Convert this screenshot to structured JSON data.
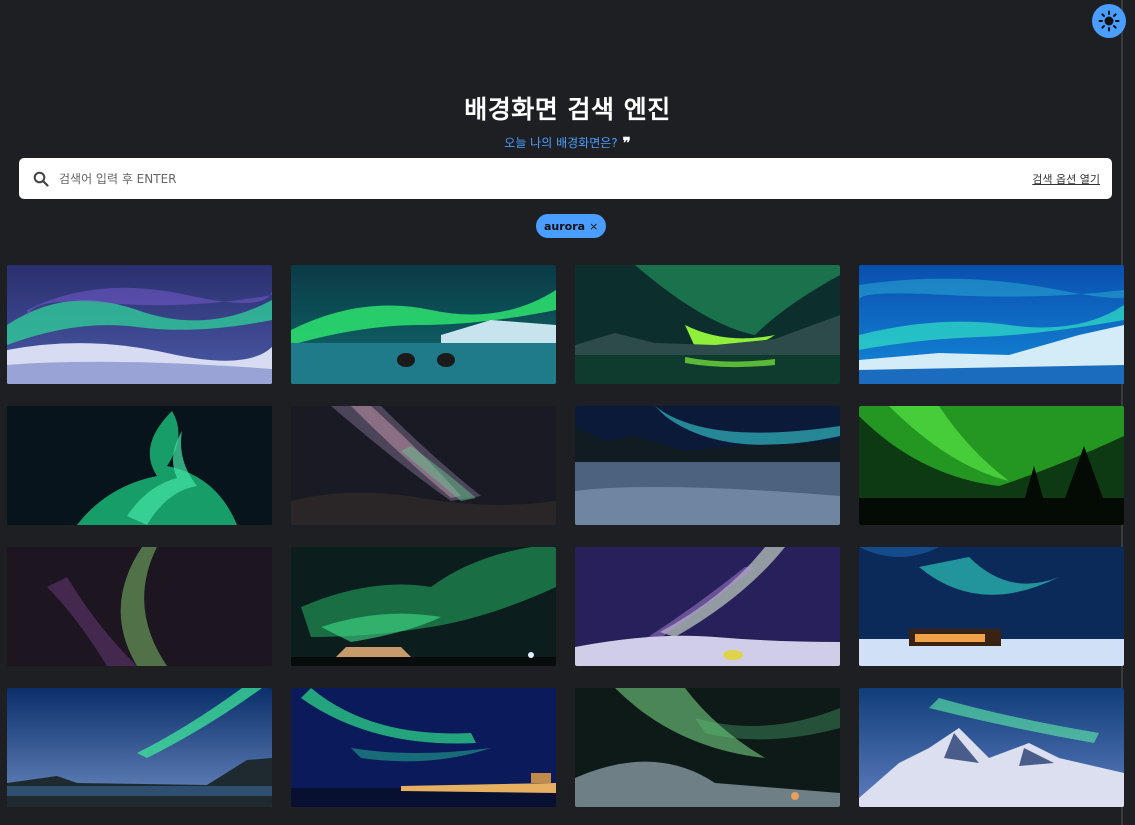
{
  "header": {
    "title": "배경화면 검색 엔진",
    "subtitle": "오늘 나의 배경화면은?"
  },
  "search": {
    "placeholder": "검색어 입력 후 ENTER",
    "options_label": "검색 옵션 열기"
  },
  "tags": [
    {
      "label": "aurora",
      "close": "×"
    }
  ],
  "icons": {
    "theme_toggle": "sun-icon",
    "search": "search-icon",
    "quote": "quote-icon"
  },
  "colors": {
    "background": "#1e1f22",
    "accent": "#4a9eff"
  },
  "results": [
    {
      "name": "aurora-snowfield"
    },
    {
      "name": "aurora-icy-river-rocks"
    },
    {
      "name": "aurora-lake-reflection"
    },
    {
      "name": "aurora-blue-glacier"
    },
    {
      "name": "aurora-swirl-dark-sky"
    },
    {
      "name": "milky-way-mountains"
    },
    {
      "name": "aurora-frozen-lake-forest"
    },
    {
      "name": "aurora-green-trees"
    },
    {
      "name": "aurora-purple-starry"
    },
    {
      "name": "aurora-green-cabin"
    },
    {
      "name": "aurora-purple-tent"
    },
    {
      "name": "aurora-lit-cabin-snow"
    },
    {
      "name": "aurora-coast-rocks"
    },
    {
      "name": "aurora-harbor-lights"
    },
    {
      "name": "aurora-dark-hills"
    },
    {
      "name": "aurora-snowy-peaks"
    }
  ]
}
